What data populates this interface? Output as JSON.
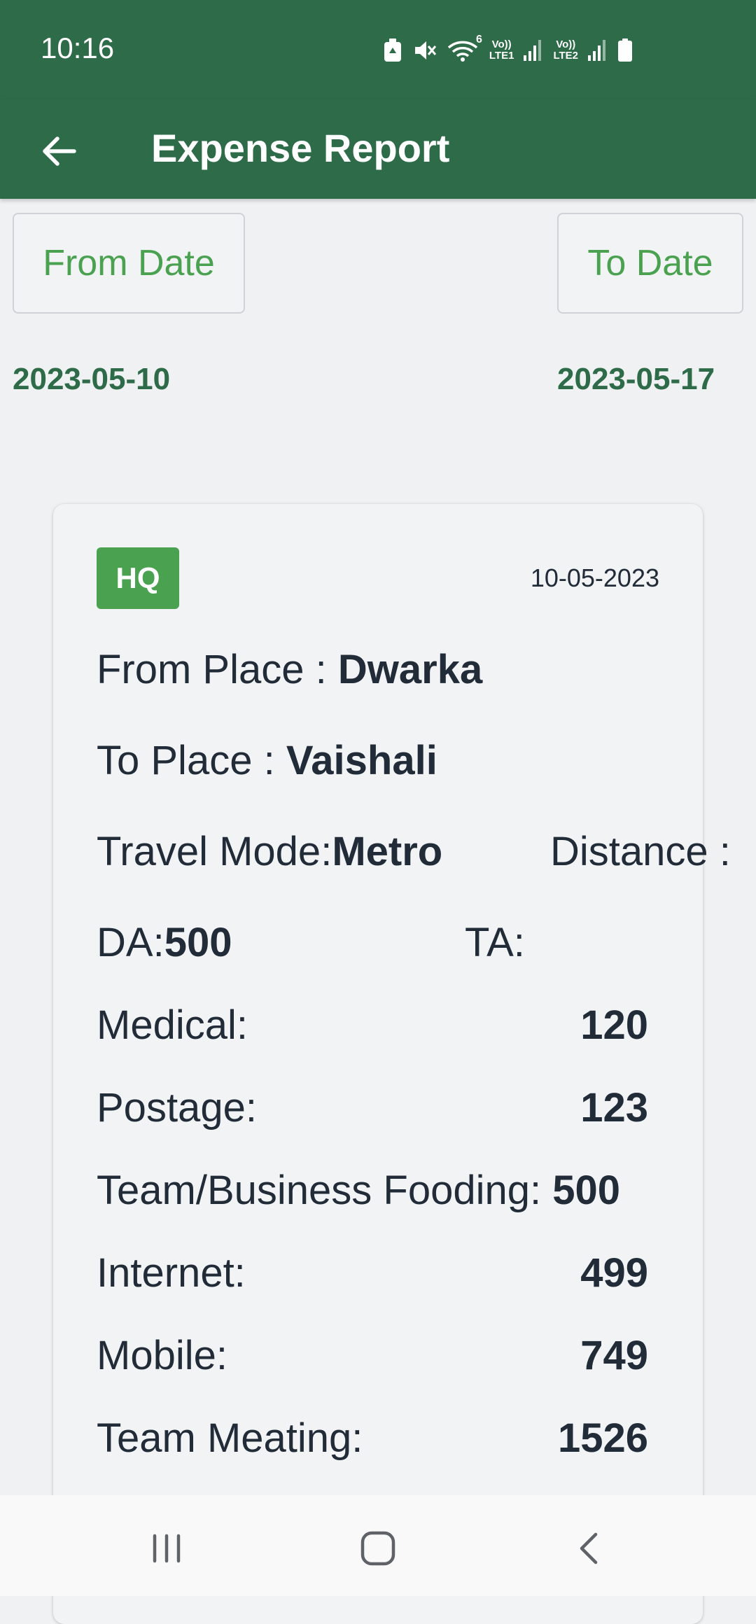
{
  "status_bar": {
    "time": "10:16",
    "lte1_label": "LTE1",
    "lte2_label": "LTE2",
    "volte_label": "Vo))",
    "wifi_badge": "6"
  },
  "header": {
    "title": "Expense Report",
    "background_color": "#2e6b48"
  },
  "filters": {
    "from_date_label": "From Date",
    "to_date_label": "To Date",
    "from_date_value": "2023-05-10",
    "to_date_value": "2023-05-17",
    "accent_color": "#4aa150"
  },
  "expense_card": {
    "badge": "HQ",
    "date": "10-05-2023",
    "from_place_label": "From Place : ",
    "from_place_value": "Dwarka",
    "to_place_label": "To Place : ",
    "to_place_value": "Vaishali",
    "travel_mode_label": "Travel Mode:",
    "travel_mode_value": "Metro",
    "distance_label": "Distance :",
    "da_label": "DA:",
    "da_value": "500",
    "ta_label": "TA:",
    "medical_label": "Medical:",
    "medical_value": "120",
    "postage_label": "Postage:",
    "postage_value": "123",
    "fooding_label": "Team/Business Fooding: ",
    "fooding_value": "500",
    "internet_label": "Internet:",
    "internet_value": "499",
    "mobile_label": "Mobile:",
    "mobile_value": "749",
    "meeting_label": "Team Meating:",
    "meeting_value": "1526"
  },
  "nav_bar": {
    "icons": [
      "recent-apps-icon",
      "home-icon",
      "back-icon"
    ]
  }
}
